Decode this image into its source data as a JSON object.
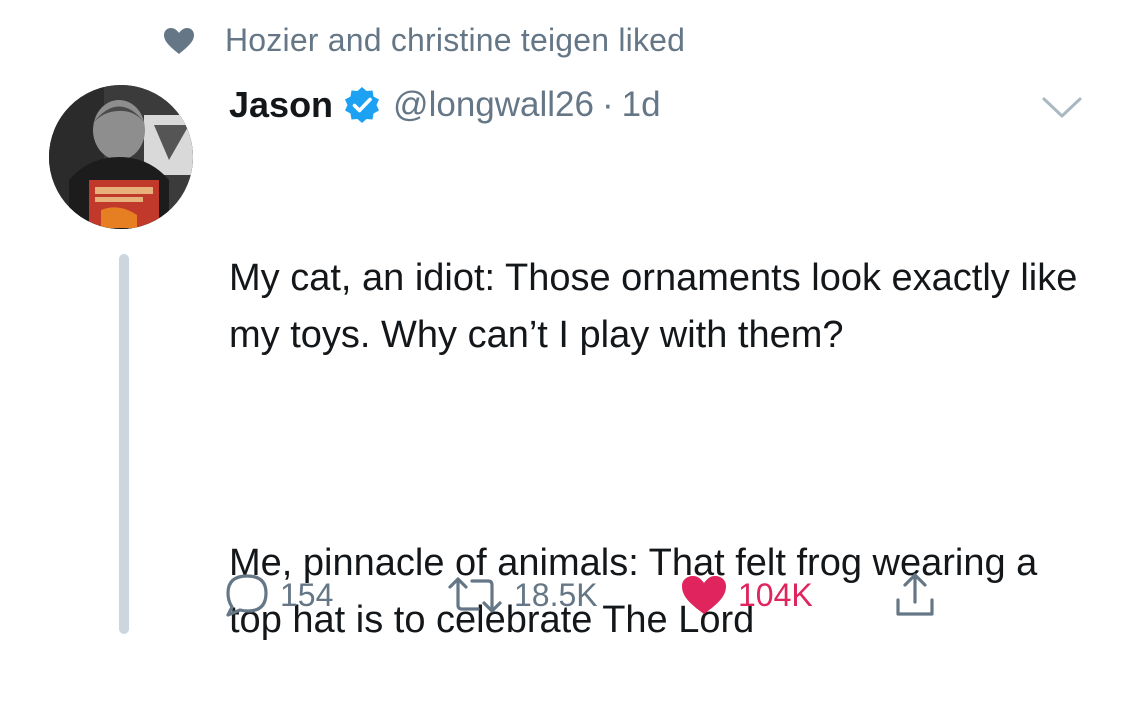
{
  "social_context": {
    "icon": "heart-icon",
    "text": "Hozier and christine teigen liked"
  },
  "tweet": {
    "author_name": "Jason",
    "verified": true,
    "handle": "@longwall26",
    "separator": "·",
    "time": "1d",
    "body_paragraphs": [
      "My cat, an idiot: Those ornaments look exactly like my toys. Why can’t I play with them?",
      "Me, pinnacle of animals: That felt frog wearing a top hat is to celebrate The Lord"
    ]
  },
  "actions": {
    "reply_count": "154",
    "retweet_count": "18.5K",
    "like_count": "104K",
    "liked": true
  },
  "colors": {
    "text_primary": "#14171a",
    "text_secondary": "#657786",
    "verified_blue": "#1da1f2",
    "like_red": "#e0245e",
    "thread_line": "#ccd6dd"
  }
}
